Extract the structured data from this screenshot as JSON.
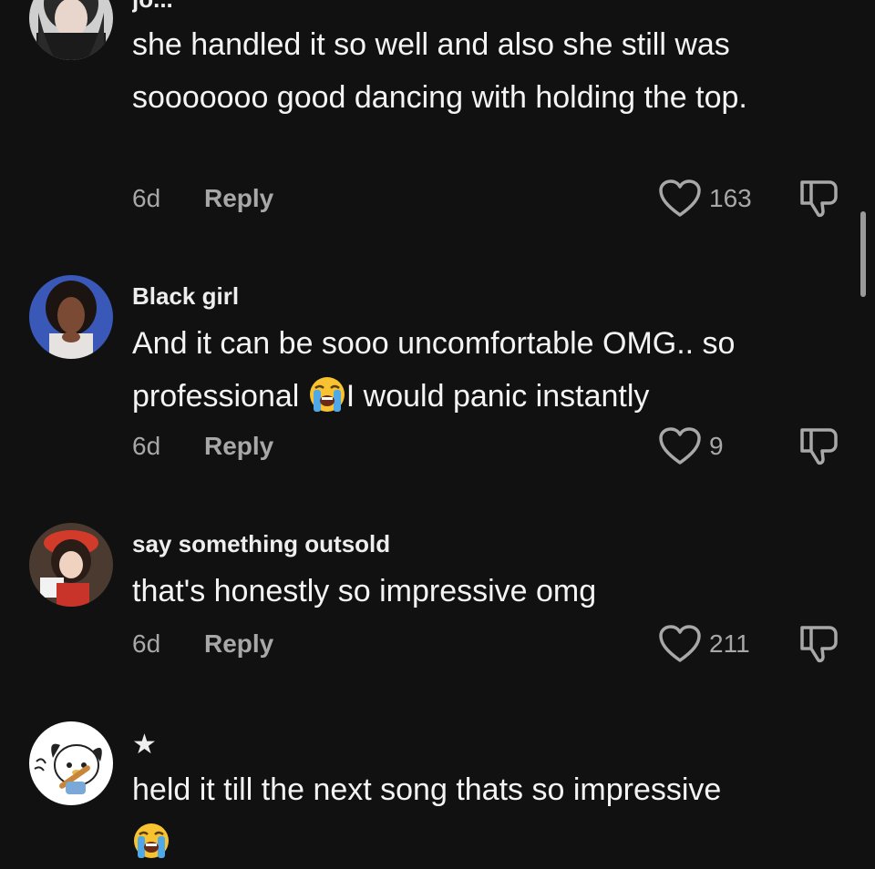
{
  "comments": [
    {
      "username": "jo...",
      "text": "she handled it so well and also she still was sooooooo good dancing with holding the top.",
      "time": "6d",
      "reply": "Reply",
      "likes": "163"
    },
    {
      "username": "Black girl",
      "text_before_emoji": "And it can be sooo uncomfortable OMG.. so professional ",
      "emoji": "loudly-crying-face",
      "text_after_emoji": "I would panic instantly",
      "time": "6d",
      "reply": "Reply",
      "likes": "9"
    },
    {
      "username": "say something outsold",
      "text": "that's honestly so impressive omg",
      "time": "6d",
      "reply": "Reply",
      "likes": "211"
    },
    {
      "username": "★",
      "text": "held it till the next song thats so impressive",
      "emoji": "loudly-crying-face"
    }
  ],
  "colors": {
    "background": "#111111",
    "text": "#f4f4f4",
    "meta": "#a8a8a8"
  }
}
